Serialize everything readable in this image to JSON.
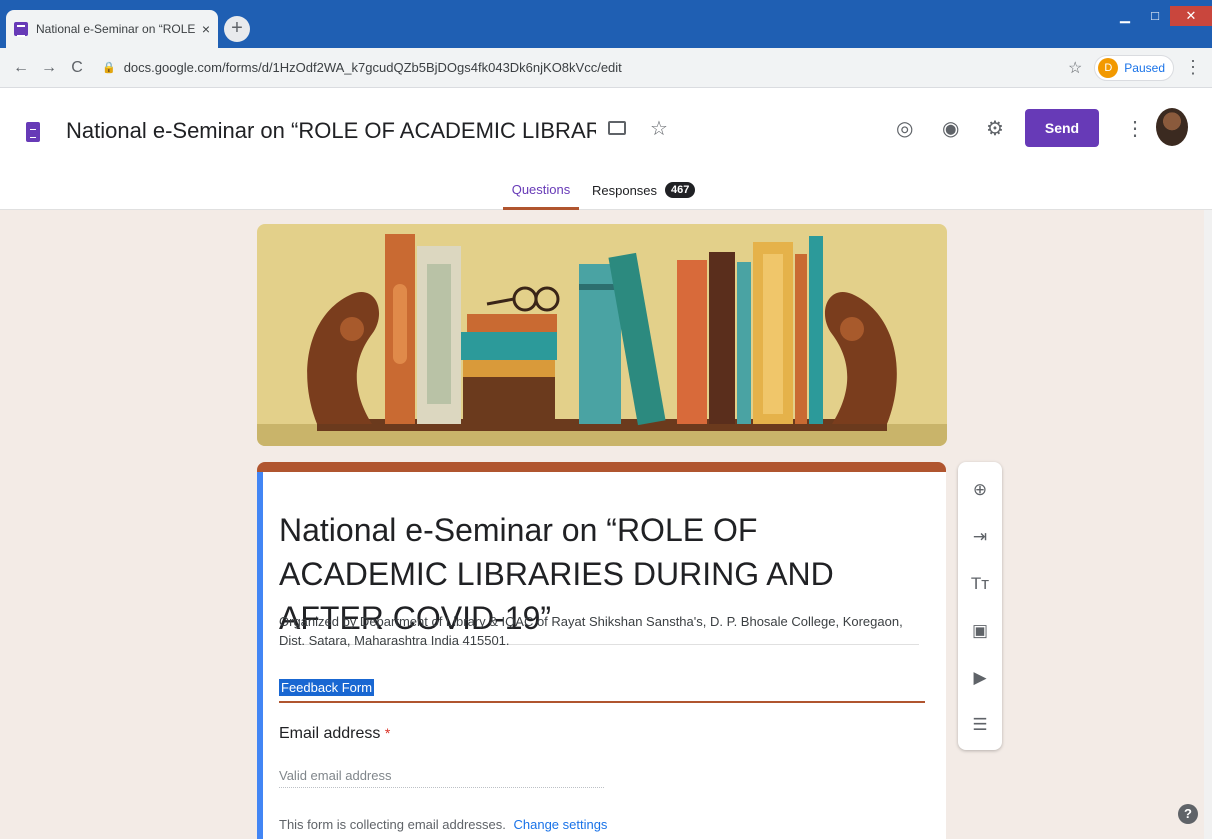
{
  "browser": {
    "tab_title": "National e-Seminar on “ROLE OF",
    "tab_close": "×",
    "new_tab": "+",
    "back": "←",
    "forward": "→",
    "reload": "C",
    "url": "docs.google.com/forms/d/1HzOdf2WA_k7gcudQZb5BjDOgs4fk043Dk6njKO8kVcc/edit",
    "profile_initial": "D",
    "profile_status": "Paused",
    "menu": "⋮",
    "star": "☆",
    "lock": "🔒",
    "minimize": "▁",
    "maximize": "□",
    "close": "✕"
  },
  "header": {
    "title": "National e-Seminar on “ROLE OF ACADEMIC LIBRARIES DUF",
    "star": "☆",
    "palette": "◎",
    "preview": "◉",
    "settings": "⚙",
    "send_label": "Send",
    "more": "⋮"
  },
  "tabs": {
    "questions": "Questions",
    "responses": "Responses",
    "responses_count": "467"
  },
  "form": {
    "title": "National e-Seminar on “ROLE OF ACADEMIC LIBRARIES DURING AND AFTER COVID-19”",
    "description": "Organized by Department of Library & IQAC of Rayat Shikshan Sanstha's,  D. P. Bhosale College, Koregaon, Dist. Satara, Maharashtra India 415501.",
    "subtitle": "Feedback Form",
    "email_label": "Email address",
    "required_mark": "*",
    "email_placeholder": "Valid email address",
    "collect_note": "This form is collecting email addresses.",
    "change_settings": "Change settings"
  },
  "toolbar": {
    "add_question": "⊕",
    "import_questions": "⇥",
    "add_title": "Tт",
    "add_image": "▣",
    "add_video": "▶",
    "add_section": "☰"
  },
  "help": "?",
  "colors": {
    "accent": "#673ab7",
    "theme": "#b0552f",
    "background": "#f3ebe6",
    "chrome_titlebar": "#1f5fb3"
  }
}
